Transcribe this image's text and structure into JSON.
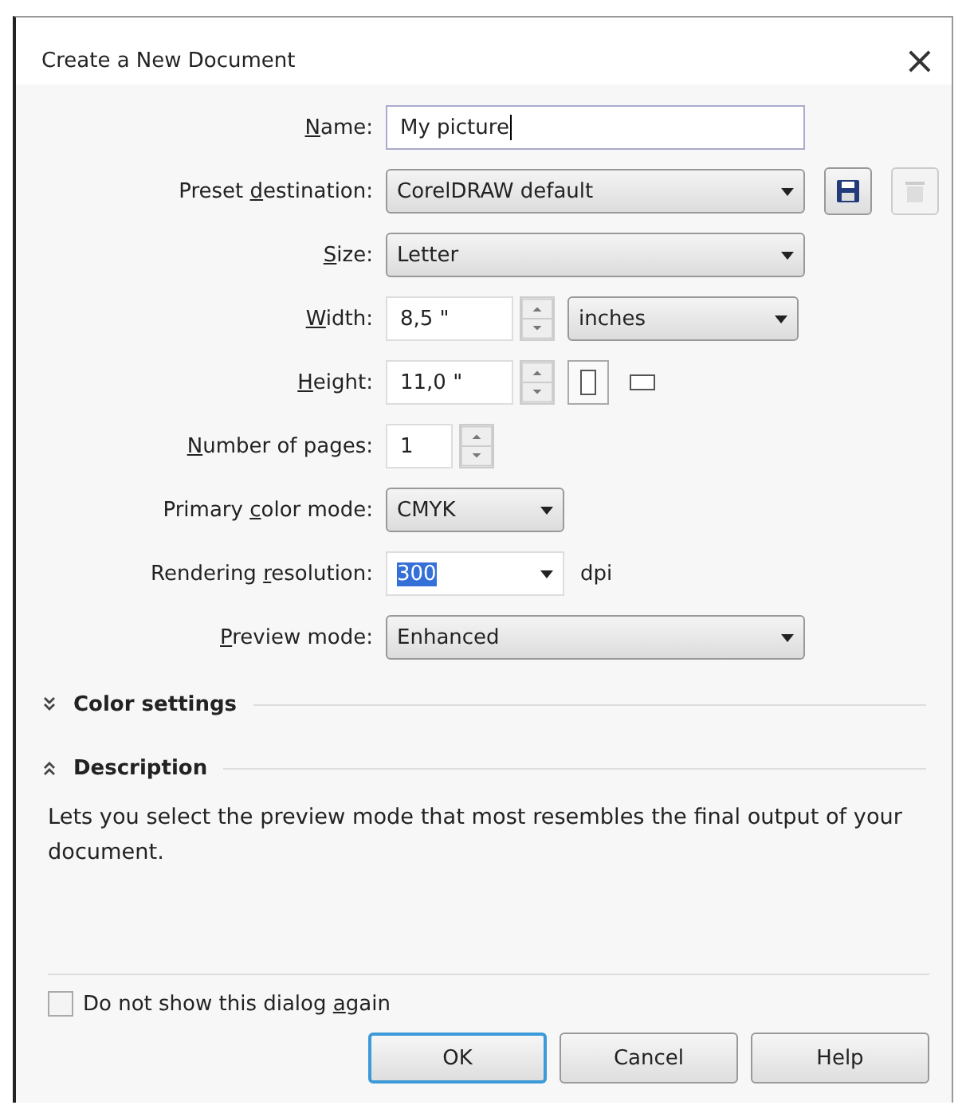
{
  "window": {
    "title": "Create a New Document",
    "close": "×"
  },
  "rows": [
    {
      "label": "Name:",
      "items": [
        {
          "kind": "text_field",
          "value": "My picture",
          "focused": true
        }
      ]
    },
    {
      "label": "Preset destination:",
      "items": [
        {
          "kind": "combo",
          "value": "CorelDRAW default"
        },
        {
          "kind": "save_button",
          "disabled": false
        },
        {
          "kind": "delete_button",
          "disabled": true
        }
      ]
    },
    {
      "label": "Size:",
      "items": [
        {
          "kind": "combo",
          "value": "Letter"
        }
      ]
    },
    {
      "label": "Width:",
      "items": [
        {
          "kind": "spin_field",
          "value": "8,5 \""
        },
        {
          "kind": "combo",
          "value": "inches"
        }
      ]
    },
    {
      "label": "Height:",
      "items": [
        {
          "kind": "spin_field",
          "value": "11,0 \""
        },
        {
          "kind": "portrait_toggle",
          "selected": true
        },
        {
          "kind": "landscape_toggle",
          "selected": false
        }
      ]
    },
    {
      "label": "Number of pages:",
      "items": [
        {
          "kind": "spin_field",
          "value": "1"
        }
      ]
    },
    {
      "label": "Primary color mode:",
      "items": [
        {
          "kind": "combo",
          "value": "CMYK"
        }
      ]
    },
    {
      "label": "Rendering resolution:",
      "items": [
        {
          "kind": "editable_combo",
          "value": "300",
          "text_selected": true
        },
        {
          "kind": "unit_label",
          "value": "dpi"
        }
      ]
    },
    {
      "label": "Preview mode:",
      "items": [
        {
          "kind": "combo",
          "value": "Enhanced"
        }
      ]
    }
  ],
  "sections": [
    {
      "title": "Color settings",
      "expanded": false
    },
    {
      "title": "Description",
      "expanded": true,
      "text": "Lets you select the preview mode that most resembles the final output of your document."
    }
  ],
  "dont_show_again": {
    "label": "Do not show this dialog again",
    "checked": false
  },
  "buttons": [
    {
      "label": "OK",
      "default": true
    },
    {
      "label": "Cancel",
      "default": false
    },
    {
      "label": "Help",
      "default": false
    }
  ]
}
